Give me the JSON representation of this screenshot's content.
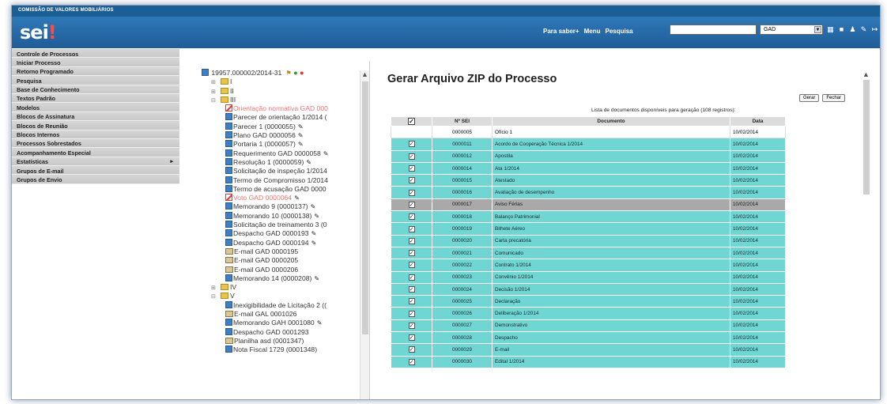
{
  "header": {
    "org": "COMISSÃO DE VALORES MOBILIÁRIOS",
    "logo": "sei",
    "nav": [
      "Para saber+",
      "Menu",
      "Pesquisa"
    ],
    "unit_value": "GAD",
    "icons": [
      "grid-icon",
      "stop-icon",
      "user-icon",
      "tool-icon",
      "exit-icon"
    ]
  },
  "menu": [
    "Controle de Processos",
    "Iniciar Processo",
    "Retorno Programado",
    "Pesquisa",
    "Base de Conhecimento",
    "Textos Padrão",
    "Modelos",
    "Blocos de Assinatura",
    "Blocos de Reunião",
    "Blocos Internos",
    "Processos Sobrestados",
    "Acompanhamento Especial",
    "Estatísticas",
    "Grupos de E-mail",
    "Grupos de Envio"
  ],
  "tree": {
    "process": "19957.000002/2014-31",
    "rows": [
      {
        "pfx": "⊞",
        "icon": "folder",
        "text": "I"
      },
      {
        "pfx": "⊞",
        "icon": "folder",
        "text": "II"
      },
      {
        "pfx": "⊟",
        "icon": "folder",
        "text": "III"
      },
      {
        "pfx": "",
        "icon": "cancel",
        "text": "Orientação normativa GAD 000",
        "red": true
      },
      {
        "pfx": "",
        "icon": "doc",
        "text": "Parecer de orientação 1/2014 ("
      },
      {
        "pfx": "",
        "icon": "doc",
        "text": "Parecer 1 (0000055)",
        "pen": true
      },
      {
        "pfx": "",
        "icon": "doc",
        "text": "Plano GAD 0000056",
        "pen": true
      },
      {
        "pfx": "",
        "icon": "doc",
        "text": "Portaria 1 (0000057)",
        "pen": true
      },
      {
        "pfx": "",
        "icon": "doc",
        "text": "Requerimento GAD 0000058",
        "pen": true
      },
      {
        "pfx": "",
        "icon": "doc",
        "text": "Resolução 1 (0000059)",
        "pen": true
      },
      {
        "pfx": "",
        "icon": "doc",
        "text": "Solicitação de inspeção 1/2014"
      },
      {
        "pfx": "",
        "icon": "doc",
        "text": "Termo de Compromisso 1/2014"
      },
      {
        "pfx": "",
        "icon": "doc",
        "text": "Termo de acusação GAD 0000"
      },
      {
        "pfx": "",
        "icon": "cancel",
        "text": "Voto GAD 0000064",
        "red": true,
        "pen": true
      },
      {
        "pfx": "",
        "icon": "doc",
        "text": "Memorando 9 (0000137)",
        "pen": true
      },
      {
        "pfx": "",
        "icon": "doc",
        "text": "Memorando 10 (0000138)",
        "pen": true
      },
      {
        "pfx": "",
        "icon": "doc",
        "text": "Solicitação de treinamento 3 (0"
      },
      {
        "pfx": "",
        "icon": "doc",
        "text": "Despacho GAD 0000193",
        "pen": true
      },
      {
        "pfx": "",
        "icon": "doc",
        "text": "Despacho GAD 0000194",
        "pen": true
      },
      {
        "pfx": "",
        "icon": "mail",
        "text": "E-mail GAD 0000195"
      },
      {
        "pfx": "",
        "icon": "mail",
        "text": "E-mail GAD 0000205"
      },
      {
        "pfx": "",
        "icon": "mail",
        "text": "E-mail GAD 0000206"
      },
      {
        "pfx": "",
        "icon": "doc",
        "text": "Memorando 14 (0000208)",
        "pen": true
      },
      {
        "pfx": "⊞",
        "icon": "folder",
        "text": "IV"
      },
      {
        "pfx": "⊟",
        "icon": "folder",
        "text": "V"
      },
      {
        "pfx": "",
        "icon": "doc",
        "text": "Inexigibilidade de Licitação 2 (("
      },
      {
        "pfx": "",
        "icon": "mail",
        "text": "E-mail GAL 0001026"
      },
      {
        "pfx": "",
        "icon": "doc",
        "text": "Memorando GAH 0001080",
        "pen": true
      },
      {
        "pfx": "",
        "icon": "doc",
        "text": "Despacho GAD 0001293"
      },
      {
        "pfx": "",
        "icon": "mail",
        "text": "Planilha asd (0001347)"
      },
      {
        "pfx": "",
        "icon": "doc",
        "text": "Nota Fiscal 1729 (0001348)"
      }
    ]
  },
  "panel": {
    "title": "Gerar Arquivo ZIP do Processo",
    "btn_gerar": "Gerar",
    "btn_fechar": "Fechar",
    "caption": "Lista de documentos disponíveis para geração (108 registros):",
    "columns": [
      "Nº SEI",
      "Documento",
      "Data"
    ],
    "rows": [
      {
        "num": "0000005",
        "doc": "Ofício 1",
        "date": "10/02/2014",
        "style": "white"
      },
      {
        "num": "0000011",
        "doc": "Acordo de Cooperação Técnica 1/2014",
        "date": "10/02/2014",
        "style": "cyan"
      },
      {
        "num": "0000012",
        "doc": "Apostila",
        "date": "10/02/2014",
        "style": "cyan"
      },
      {
        "num": "0000014",
        "doc": "Ata 1/2014",
        "date": "10/02/2014",
        "style": "cyan"
      },
      {
        "num": "0000015",
        "doc": "Atestado",
        "date": "10/02/2014",
        "style": "cyan"
      },
      {
        "num": "0000016",
        "doc": "Avaliação de desempenho",
        "date": "10/02/2014",
        "style": "cyan"
      },
      {
        "num": "0000017",
        "doc": "Aviso Férias",
        "date": "10/02/2014",
        "style": "sel"
      },
      {
        "num": "0000018",
        "doc": "Balanço Patrimonial",
        "date": "10/02/2014",
        "style": "cyan"
      },
      {
        "num": "0000019",
        "doc": "Bilhete Aéreo",
        "date": "10/02/2014",
        "style": "cyan"
      },
      {
        "num": "0000020",
        "doc": "Carta precatória",
        "date": "10/02/2014",
        "style": "cyan"
      },
      {
        "num": "0000021",
        "doc": "Comunicado",
        "date": "10/02/2014",
        "style": "cyan"
      },
      {
        "num": "0000022",
        "doc": "Contrato 1/2014",
        "date": "10/02/2014",
        "style": "cyan"
      },
      {
        "num": "0000023",
        "doc": "Convênio 1/2014",
        "date": "10/02/2014",
        "style": "cyan"
      },
      {
        "num": "0000024",
        "doc": "Decisão 1/2014",
        "date": "10/02/2014",
        "style": "cyan"
      },
      {
        "num": "0000025",
        "doc": "Declaração",
        "date": "10/02/2014",
        "style": "cyan"
      },
      {
        "num": "0000026",
        "doc": "Deliberação 1/2014",
        "date": "10/02/2014",
        "style": "cyan"
      },
      {
        "num": "0000027",
        "doc": "Demonstrativo",
        "date": "10/02/2014",
        "style": "cyan"
      },
      {
        "num": "0000028",
        "doc": "Despacho",
        "date": "10/02/2014",
        "style": "cyan"
      },
      {
        "num": "0000029",
        "doc": "E-mail",
        "date": "10/02/2014",
        "style": "cyan"
      },
      {
        "num": "0000030",
        "doc": "Edital 1/2014",
        "date": "10/02/2014",
        "style": "cyan"
      }
    ]
  }
}
